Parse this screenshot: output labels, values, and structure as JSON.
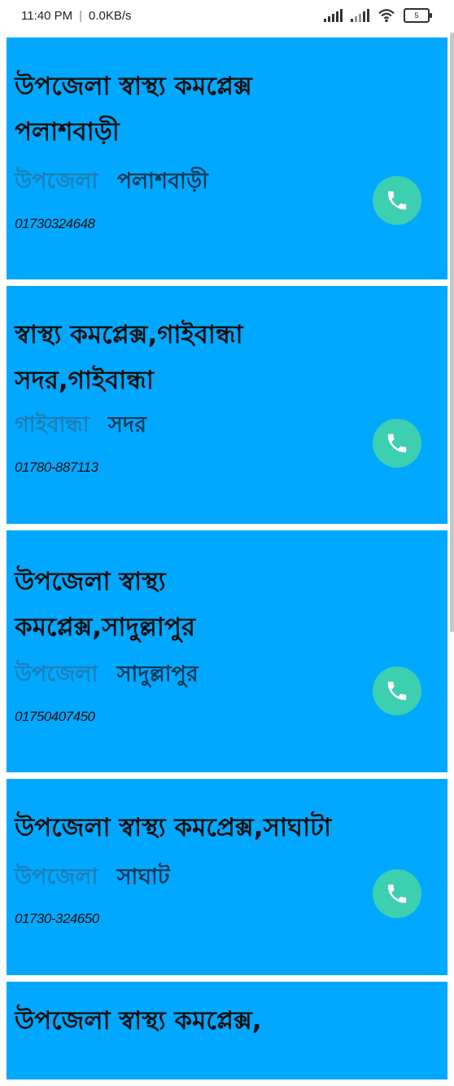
{
  "status_bar": {
    "time": "11:40 PM",
    "separator": "|",
    "net_speed": "0.0KB/s",
    "battery": "5"
  },
  "colors": {
    "card_bg": "#00a8ff",
    "call_button": "#3ccfb0",
    "area_text": "#1e7fb8"
  },
  "cards": [
    {
      "title_l1": "উপজেলা স্বাস্থ্য কমপ্লেক্স",
      "title_l2": "পলাশবাড়ী",
      "area": "উপজেলা",
      "name": "পলাশবাড়ী",
      "phone": "01730324648",
      "call_icon": "phone-icon"
    },
    {
      "title_l1": "স্বাস্থ্য কমপ্লেক্স,গাইবান্ধা",
      "title_l2": "সদর,গাইবান্ধা",
      "area": "গাইবান্ধা",
      "name": "সদর",
      "phone": "01780-887113",
      "call_icon": "phone-icon"
    },
    {
      "title_l1": "উপজেলা স্বাস্থ্য",
      "title_l2": "কমপ্লেক্স,সাদুল্লাপুর",
      "area": "উপজেলা",
      "name": "সাদুল্লাপুর",
      "phone": "01750407450",
      "call_icon": "phone-icon"
    },
    {
      "title_l1": "উপজেলা স্বাস্থ্য কমপ্রেক্স,সাঘাটা",
      "area": "উপজেলা",
      "name": "সাঘাট",
      "phone": "01730-324650",
      "call_icon": "phone-icon"
    },
    {
      "title_l1": "উপজেলা স্বাস্থ্য কমপ্লেক্স,"
    }
  ]
}
